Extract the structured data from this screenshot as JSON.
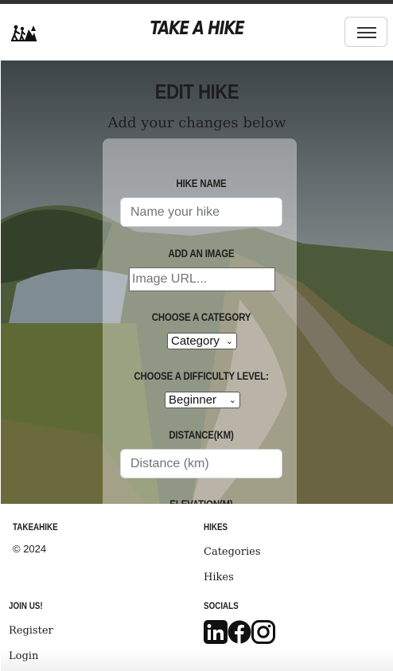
{
  "navbar": {
    "brand": "TAKE A HIKE",
    "logo_icon": "hikers-icon",
    "menu_icon": "hamburger-menu-icon"
  },
  "form": {
    "title": "EDIT HIKE",
    "subtitle": "Add your changes below",
    "hike_name_label": "HIKE NAME",
    "hike_name_placeholder": "Name your hike",
    "image_label": "ADD AN IMAGE",
    "image_placeholder": "Image URL...",
    "category_label": "CHOOSE A CATEGORY",
    "category_value": "Category",
    "difficulty_label": "CHOOSE A DIFFICULTY LEVEL:",
    "difficulty_value": "Beginner",
    "distance_label": "DISTANCE(KM)",
    "distance_placeholder": "Distance (km)",
    "elevation_label": "ELEVATION(M)"
  },
  "footer": {
    "brand": "TAKEAHIKE",
    "copyright": "© 2024",
    "hikes_heading": "HIKES",
    "hikes_links": [
      "Categories",
      "Hikes"
    ],
    "join_heading": "JOIN US!",
    "join_links": [
      "Register",
      "Login"
    ],
    "socials_heading": "SOCIALS",
    "social_icons": [
      "linkedin-icon",
      "facebook-icon",
      "instagram-icon"
    ]
  }
}
